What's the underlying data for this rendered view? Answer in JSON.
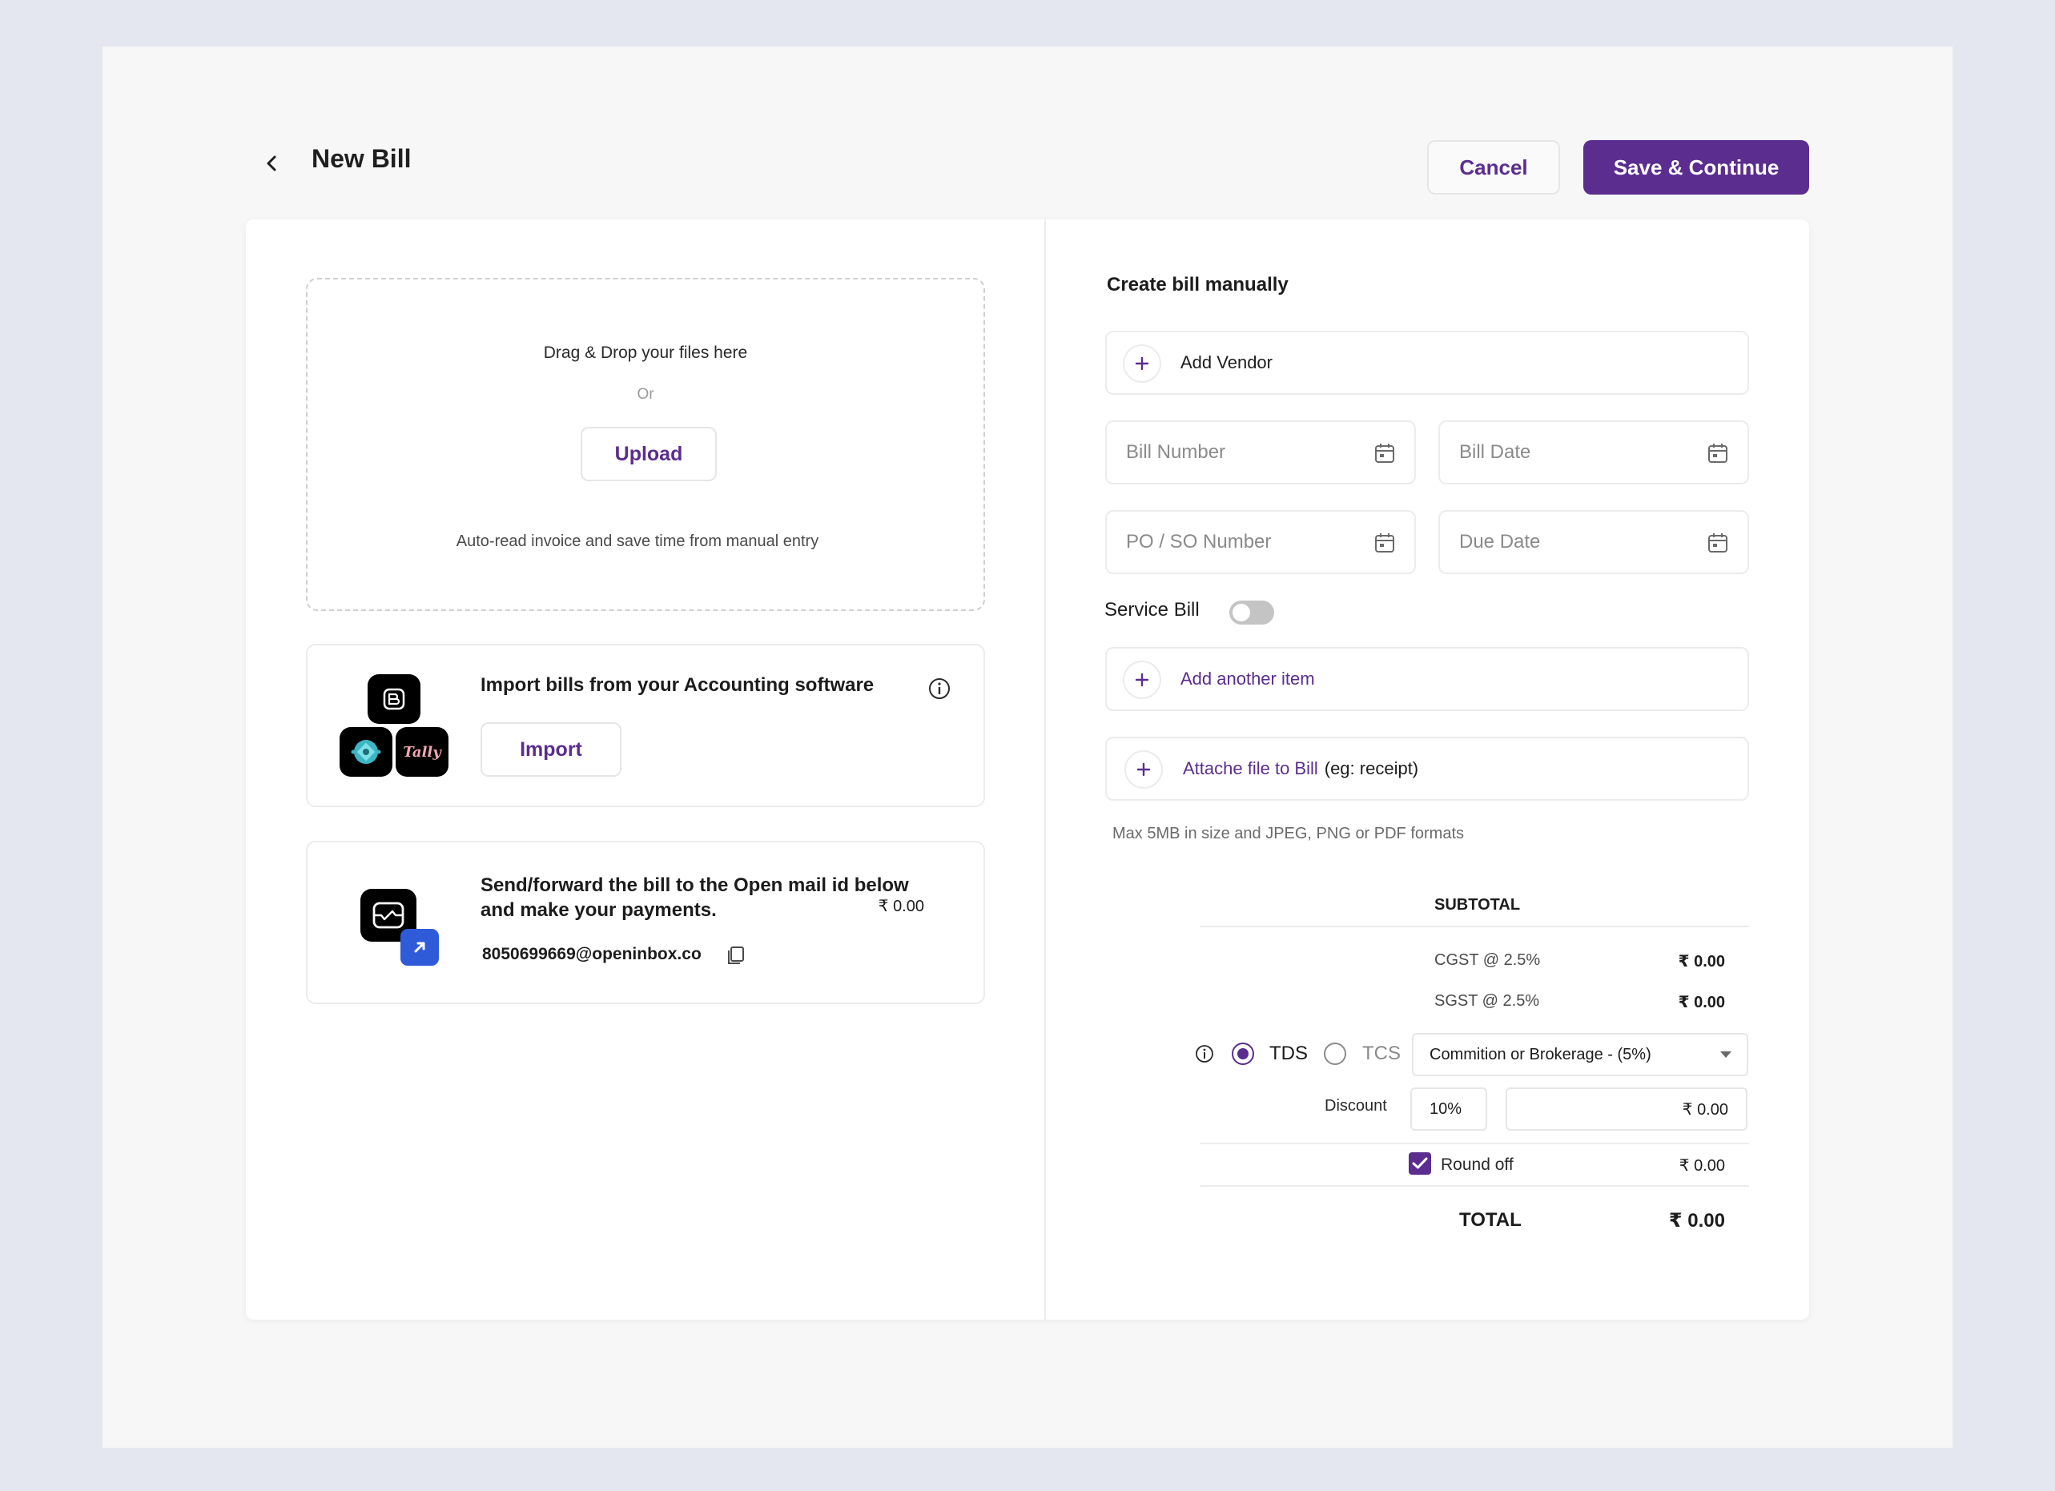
{
  "header": {
    "title": "New Bill",
    "cancel_label": "Cancel",
    "save_label": "Save & Continue"
  },
  "upload": {
    "title": "Drag & Drop your files here",
    "or": "Or",
    "button_label": "Upload",
    "hint": "Auto-read invoice and save time from manual entry"
  },
  "import": {
    "title": "Import bills from your Accounting software",
    "button_label": "Import",
    "apps": [
      "app-b-icon",
      "app-diamond-icon",
      "tally-icon"
    ],
    "tally_text": "Tally"
  },
  "mail": {
    "title": "Send/forward the bill to the Open mail id below and make your payments.",
    "email": "8050699669@openinbox.co"
  },
  "manual": {
    "title": "Create bill manually",
    "add_vendor": "Add Vendor",
    "bill_number_placeholder": "Bill Number",
    "bill_date_placeholder": "Bill Date",
    "po_number_placeholder": "PO / SO Number",
    "due_date_placeholder": "Due Date",
    "service_bill_label": "Service Bill",
    "service_bill_enabled": false,
    "add_item": "Add another item",
    "attach_link": "Attache file to Bill",
    "attach_suffix": "(eg: receipt)",
    "size_hint": "Max 5MB in size and JPEG, PNG or PDF formats"
  },
  "summary": {
    "subtotal_label": "SUBTOTAL",
    "subtotal_value": "₹ 0.00",
    "cgst_label": "CGST @ 2.5%",
    "cgst_value": "₹ 0.00",
    "sgst_label": "SGST @ 2.5%",
    "sgst_value": "₹ 0.00",
    "tds_label": "TDS",
    "tcs_label": "TCS",
    "tax_selected": "TDS",
    "tax_option": "Commition or Brokerage - (5%)",
    "discount_label": "Discount",
    "discount_percent": "10%",
    "discount_value": "₹ 0.00",
    "round_off_label": "Round off",
    "round_off_checked": true,
    "round_off_value": "₹ 0.00",
    "total_label": "TOTAL",
    "total_value": "₹ 0.00"
  },
  "colors": {
    "accent": "#5b2d8e",
    "background": "#e4e7f0",
    "panel": "#f7f7f7"
  }
}
